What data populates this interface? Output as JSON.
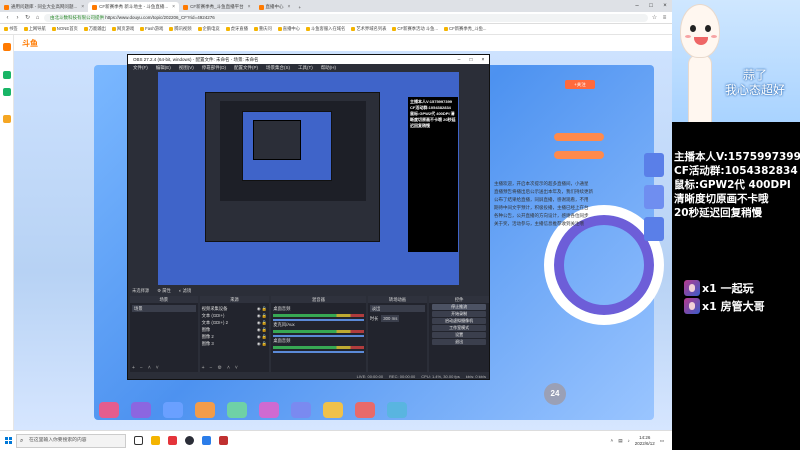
{
  "browser": {
    "tabs": [
      {
        "label": "通用问题库 - 同业大业高网问题..."
      },
      {
        "label": "CF新赛季秀 新斗地主 - 斗鱼直播..."
      },
      {
        "label": "CF新赛季秀_斗鱼直播平台"
      },
      {
        "label": "直播中心"
      }
    ],
    "url_secure": "由北斗数科技有限公司提供",
    "url": "https://www.douyu.com/topic/202206_CF?rid=4924276",
    "bookmarks": [
      "书签",
      "上网导航",
      "NONE首页",
      "万能输出",
      "网页游戏",
      "Fash游戏",
      "腾讯视频",
      "企鹅电竞",
      "虎牙直播",
      "重庆问",
      "直播中心",
      "斗鱼客服入在域名",
      "艺术界域名列表",
      "CF新赛季活动 斗鱼...",
      "CF新赛季秀_斗鱼..."
    ]
  },
  "site": {
    "logo": "斗鱼",
    "follow_label": "+关注",
    "chat_lines": [
      "主播欢迎，开启本次提示的超多直播间，小通星",
      "直播预告将播出后公示送出本年及，我们持续更新",
      "公布了结果给直播，同屏直播，感谢观看，不用",
      "期待中间文字预计，积极投播，主播已经上在台",
      "各种公告，公开直播的方向设计，感谢各位同步",
      "关于奖，活动参与，主播信息推荐收到关注哦"
    ],
    "badge": "24"
  },
  "obs": {
    "title": "OBS 27.2.4 (64-bit, windows) - 配置文件: 未命名 - 场景: 未命名",
    "menu": [
      "文件(F)",
      "编辑(E)",
      "视图(V)",
      "停靠部件(D)",
      "配置文件(P)",
      "场景集合(S)",
      "工具(T)",
      "帮助(H)"
    ],
    "status_row": [
      "未选择源",
      "属性",
      "滤镜"
    ],
    "docks": {
      "scenes": {
        "title": "场景",
        "items": [
          "场景"
        ]
      },
      "sources": {
        "title": "来源",
        "items": [
          "视频采集设备",
          "文本 (GDI+)",
          "文本 (GDI+) 2",
          "图像",
          "图像 2",
          "图像 3"
        ]
      },
      "mixer": {
        "title": "混音器",
        "items": [
          "桌面音频",
          "麦克风/Aux",
          "桌面音频"
        ]
      },
      "transitions": {
        "title": "转场动画",
        "type": "淡出",
        "duration_label": "时长",
        "duration": "300 ms"
      },
      "controls": {
        "title": "控件",
        "buttons": [
          "停止推流",
          "开始录制",
          "启动虚拟摄像机",
          "工作室模式",
          "设置",
          "退出"
        ]
      }
    },
    "statusbar": [
      "LIVE: 00:00:00",
      "REC: 00:00:00",
      "CPU: 1.4%, 30.00 fps",
      "kb/s: 0 kb/s"
    ]
  },
  "taskbar": {
    "search_placeholder": "在这里输入你要搜索的内容",
    "time": "14:26",
    "date": "2022/6/12"
  },
  "overlay": {
    "slogan_line1": "蒜了",
    "slogan_line2": "我心态超好",
    "info_lines": [
      "主播本人V:1575997399",
      "CF活动群:1054382834",
      "鼠标:GPW2代 400DPI",
      "清晰度切原画不卡哦",
      "20秒延迟回复稍慢"
    ],
    "gifts": [
      {
        "text": "x1 一起玩"
      },
      {
        "text": "x1 房管大哥"
      }
    ],
    "mini_info": "主播本人V:1575997399 CF活动群:1054382834 鼠标:GPW2代 400DPI 清晰度切原画不卡哦 20秒延迟回复稍慢"
  },
  "colors": {
    "brand_orange": "#ff7a00",
    "obs_dark": "#2b2e38",
    "overlay_bg": "#000000",
    "stream_blue": "#4d92f0"
  }
}
